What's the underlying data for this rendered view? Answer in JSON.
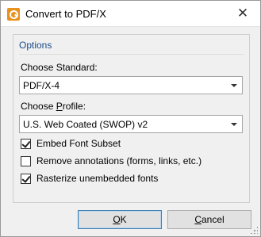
{
  "window": {
    "title": "Convert to PDF/X",
    "app_icon": "pdf-app-icon",
    "close_glyph": "✕"
  },
  "options": {
    "group_title": "Options",
    "standard_label": "Choose Standard:",
    "standard_value": "PDF/X-4",
    "profile_label_prefix": "Choose ",
    "profile_label_accel": "P",
    "profile_label_suffix": "rofile:",
    "profile_value": "U.S. Web Coated (SWOP) v2",
    "checkboxes": [
      {
        "label": "Embed Font Subset",
        "checked": true
      },
      {
        "label": "Remove annotations (forms, links, etc.)",
        "checked": false
      },
      {
        "label": "Rasterize unembedded fonts",
        "checked": true
      }
    ]
  },
  "buttons": {
    "ok_accel": "O",
    "ok_rest": "K",
    "cancel_accel": "C",
    "cancel_rest": "ancel"
  }
}
